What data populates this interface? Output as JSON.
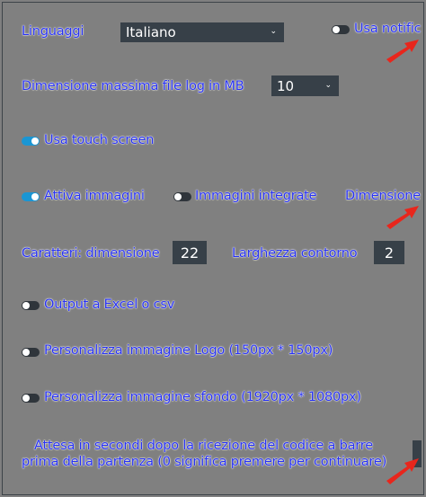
{
  "language": {
    "label": "Linguaggi",
    "value": "Italiano"
  },
  "notifications": {
    "label": "Usa notific",
    "on": false
  },
  "log_size": {
    "label": "Dimensione massima file log in MB",
    "value": "10"
  },
  "touch_screen": {
    "label": "Usa touch screen",
    "on": true
  },
  "images": {
    "enable": {
      "label": "Attiva immagini",
      "on": true
    },
    "integrated": {
      "label": "Immagini integrate",
      "on": false
    },
    "size_label": "Dimensione"
  },
  "characters": {
    "size_label": "Caratteri: dimensione",
    "size_value": "22",
    "outline_label": "Larghezza contorno",
    "outline_value": "2"
  },
  "excel_output": {
    "label": "Output a Excel o csv",
    "on": false
  },
  "custom_logo": {
    "label": "Personalizza immagine Logo (150px * 150px)",
    "on": false
  },
  "custom_background": {
    "label": "Personalizza immagine sfondo (1920px * 1080px)",
    "on": false
  },
  "barcode_wait": {
    "line1": "Attesa in secondi dopo la ricezione del codice a barre",
    "line2": "prima della partenza (0 significa premere per continuare)"
  },
  "colors": {
    "background": "#808080",
    "label_text": "#2832f2",
    "control_bg": "#374048",
    "toggle_on": "#1a96d4",
    "annotation_arrow": "#e8261c"
  }
}
